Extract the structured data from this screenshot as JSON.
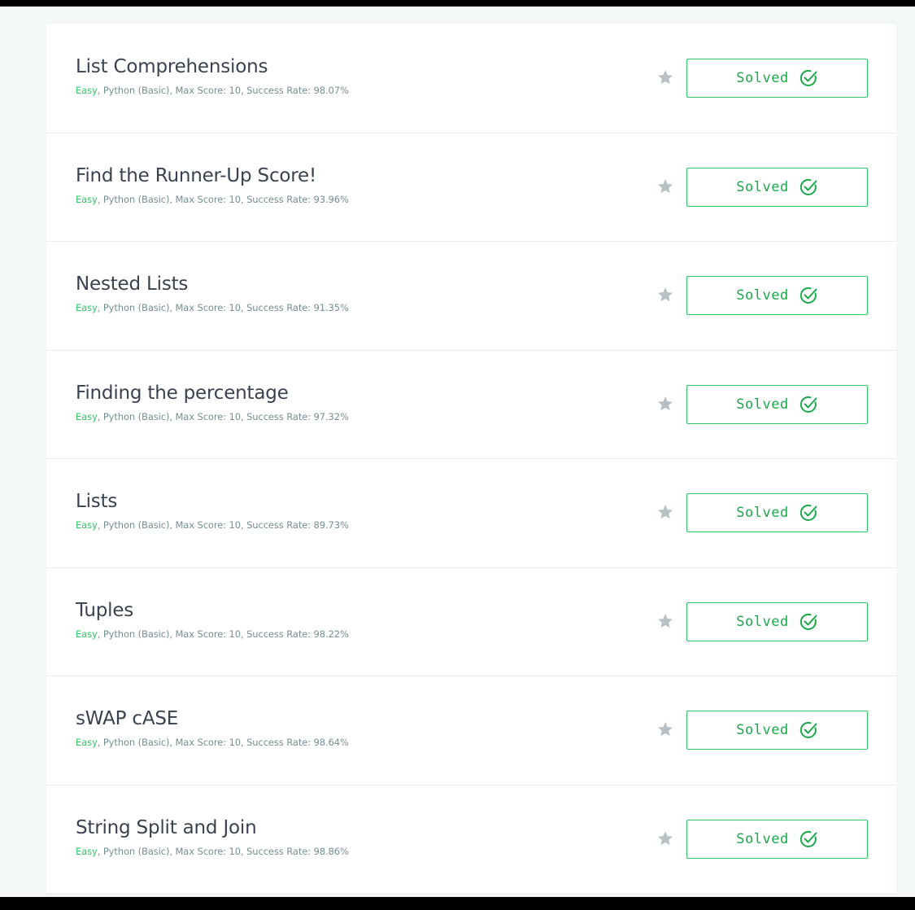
{
  "colors": {
    "accent_green": "#2ec866",
    "title_text": "#39424e",
    "meta_text": "#738f93",
    "page_background": "#f3f7f7",
    "bookmark_gray": "#b7c0c4"
  },
  "challenges": [
    {
      "title": "List Comprehensions",
      "difficulty": "Easy",
      "meta": ", Python (Basic), Max Score: 10, Success Rate: 98.07%",
      "button_label": "Solved",
      "button_icon": "check-circle-icon",
      "bookmark_icon": "star-icon"
    },
    {
      "title": "Find the Runner-Up Score!",
      "difficulty": "Easy",
      "meta": ", Python (Basic), Max Score: 10, Success Rate: 93.96%",
      "button_label": "Solved",
      "button_icon": "check-circle-icon",
      "bookmark_icon": "star-icon"
    },
    {
      "title": "Nested Lists",
      "difficulty": "Easy",
      "meta": ", Python (Basic), Max Score: 10, Success Rate: 91.35%",
      "button_label": "Solved",
      "button_icon": "check-circle-icon",
      "bookmark_icon": "star-icon"
    },
    {
      "title": "Finding the percentage",
      "difficulty": "Easy",
      "meta": ", Python (Basic), Max Score: 10, Success Rate: 97.32%",
      "button_label": "Solved",
      "button_icon": "check-circle-icon",
      "bookmark_icon": "star-icon"
    },
    {
      "title": "Lists",
      "difficulty": "Easy",
      "meta": ", Python (Basic), Max Score: 10, Success Rate: 89.73%",
      "button_label": "Solved",
      "button_icon": "check-circle-icon",
      "bookmark_icon": "star-icon"
    },
    {
      "title": "Tuples",
      "difficulty": "Easy",
      "meta": ", Python (Basic), Max Score: 10, Success Rate: 98.22%",
      "button_label": "Solved",
      "button_icon": "check-circle-icon",
      "bookmark_icon": "star-icon"
    },
    {
      "title": "sWAP cASE",
      "difficulty": "Easy",
      "meta": ", Python (Basic), Max Score: 10, Success Rate: 98.64%",
      "button_label": "Solved",
      "button_icon": "check-circle-icon",
      "bookmark_icon": "star-icon"
    },
    {
      "title": "String Split and Join",
      "difficulty": "Easy",
      "meta": ", Python (Basic), Max Score: 10, Success Rate: 98.86%",
      "button_label": "Solved",
      "button_icon": "check-circle-icon",
      "bookmark_icon": "star-icon"
    }
  ]
}
